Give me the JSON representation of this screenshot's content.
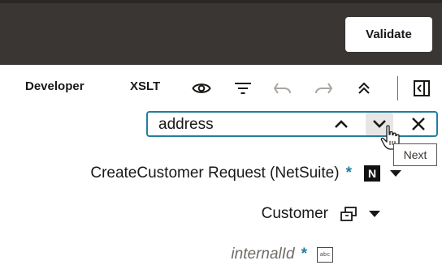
{
  "header": {
    "validate_label": "Validate",
    "colors": {
      "bar": "#3a3633",
      "accent": "#227e9e"
    }
  },
  "toolbar": {
    "developer_label": "Developer",
    "xslt_label": "XSLT",
    "icons": [
      "eye-icon",
      "filter-icon",
      "undo-icon",
      "redo-icon",
      "collapse-all-icon",
      "panel-toggle-icon"
    ]
  },
  "search": {
    "value": "address",
    "placeholder": "",
    "tooltip": "Next",
    "icons": [
      "chevron-up-icon",
      "chevron-down-icon",
      "close-icon"
    ]
  },
  "tree": {
    "root": {
      "label": "CreateCustomer Request (NetSuite)",
      "required_marker": "*",
      "badge": "N"
    },
    "customer": {
      "label": "Customer"
    },
    "internal_id": {
      "label": "internalId",
      "required_marker": "*",
      "type_icon_text": "abc"
    }
  }
}
